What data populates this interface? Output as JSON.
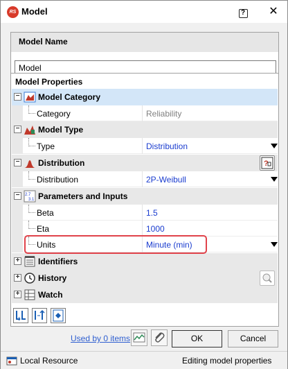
{
  "window": {
    "title": "Model",
    "help_symbol": "?",
    "close_symbol": "✕"
  },
  "model_name": {
    "header": "Model Name",
    "value": "Model"
  },
  "model_properties": {
    "header": "Model Properties",
    "categories": [
      {
        "label": "Model Category",
        "expander": "−",
        "icon": "model-category-icon",
        "props": [
          {
            "label": "Category",
            "value": "Reliability",
            "readonly": true
          }
        ]
      },
      {
        "label": "Model Type",
        "expander": "−",
        "icon": "model-type-icon",
        "props": [
          {
            "label": "Type",
            "value": "Distribution",
            "dropdown": true
          }
        ]
      },
      {
        "label": "Distribution",
        "expander": "−",
        "icon": "distribution-icon",
        "props": [
          {
            "label": "Distribution",
            "value": "2P-Weibull",
            "dropdown": true
          }
        ]
      },
      {
        "label": "Parameters and Inputs",
        "expander": "−",
        "icon": "parameters-icon",
        "props": [
          {
            "label": "Beta",
            "value": "1.5"
          },
          {
            "label": "Eta",
            "value": "1000"
          },
          {
            "label": "Units",
            "value": "Minute (min)",
            "dropdown": true
          }
        ]
      },
      {
        "label": "Identifiers",
        "expander": "+",
        "icon": "identifiers-icon"
      },
      {
        "label": "History",
        "expander": "+",
        "icon": "history-icon"
      },
      {
        "label": "Watch",
        "expander": "+",
        "icon": "watch-icon"
      }
    ]
  },
  "footer": {
    "used_by": "Used by 0 items",
    "ok": "OK",
    "cancel": "Cancel"
  },
  "statusbar": {
    "left": "Local Resource",
    "right": "Editing model properties"
  },
  "colors": {
    "value_blue": "#1a3ccf",
    "highlight_red": "#e0424a",
    "selected_row": "#d3e6f8"
  }
}
